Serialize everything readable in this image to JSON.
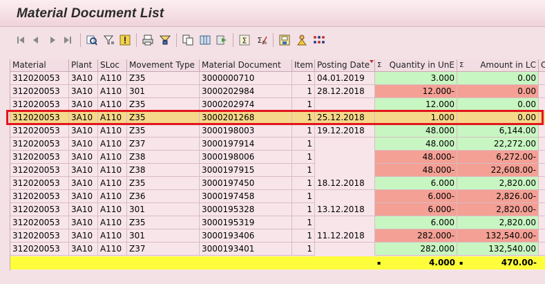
{
  "window": {
    "title": "Material Document List"
  },
  "toolbar": {
    "icons": [
      "first-page-icon",
      "previous-page-icon",
      "next-page-icon",
      "last-page-icon",
      "details-icon",
      "filter-icon",
      "exception-icon",
      "print-icon",
      "sum-up-icon",
      "export-icon",
      "layout-icon",
      "transfer-icon",
      "sum-icon",
      "subtotal-icon",
      "save-layout-icon",
      "user-icon",
      "legend-icon"
    ]
  },
  "columns": [
    "Material",
    "Plant",
    "SLoc",
    "Movement Type",
    "Material Document",
    "Item",
    "Posting Date",
    "Quantity in UnE",
    "Amount in LC"
  ],
  "sum_symbol": "Σ",
  "rows": [
    {
      "material": "312020053",
      "plant": "3A10",
      "sloc": "A110",
      "mvt": "Z35",
      "doc": "3000000710",
      "item": "1",
      "date": "04.01.2019",
      "qty": "3.000",
      "qty_color": "green",
      "amt": "0.00",
      "amt_color": "green"
    },
    {
      "material": "312020053",
      "plant": "3A10",
      "sloc": "A110",
      "mvt": "301",
      "doc": "3000202984",
      "item": "1",
      "date": "28.12.2018",
      "qty": "12.000-",
      "qty_color": "red",
      "amt": "0.00",
      "amt_color": "red"
    },
    {
      "material": "312020053",
      "plant": "3A10",
      "sloc": "A110",
      "mvt": "Z35",
      "doc": "3000202974",
      "item": "1",
      "date": "",
      "qty": "12.000",
      "qty_color": "green",
      "amt": "0.00",
      "amt_color": "green"
    },
    {
      "material": "312020053",
      "plant": "3A10",
      "sloc": "A110",
      "mvt": "Z35",
      "doc": "3000201268",
      "item": "1",
      "date": "25.12.2018",
      "qty": "1.000",
      "qty_color": "selected",
      "amt": "0.00",
      "amt_color": "selected",
      "selected": true
    },
    {
      "material": "312020053",
      "plant": "3A10",
      "sloc": "A110",
      "mvt": "Z35",
      "doc": "3000198003",
      "item": "1",
      "date": "19.12.2018",
      "qty": "48.000",
      "qty_color": "green",
      "amt": "6,144.00",
      "amt_color": "green"
    },
    {
      "material": "312020053",
      "plant": "3A10",
      "sloc": "A110",
      "mvt": "Z37",
      "doc": "3000197914",
      "item": "1",
      "date": "",
      "qty": "48.000",
      "qty_color": "green",
      "amt": "22,272.00",
      "amt_color": "green"
    },
    {
      "material": "312020053",
      "plant": "3A10",
      "sloc": "A110",
      "mvt": "Z38",
      "doc": "3000198006",
      "item": "1",
      "date": "",
      "qty": "48.000-",
      "qty_color": "red",
      "amt": "6,272.00-",
      "amt_color": "red"
    },
    {
      "material": "312020053",
      "plant": "3A10",
      "sloc": "A110",
      "mvt": "Z38",
      "doc": "3000197915",
      "item": "1",
      "date": "",
      "qty": "48.000-",
      "qty_color": "red",
      "amt": "22,608.00-",
      "amt_color": "red"
    },
    {
      "material": "312020053",
      "plant": "3A10",
      "sloc": "A110",
      "mvt": "Z35",
      "doc": "3000197450",
      "item": "1",
      "date": "18.12.2018",
      "qty": "6.000",
      "qty_color": "green",
      "amt": "2,820.00",
      "amt_color": "green"
    },
    {
      "material": "312020053",
      "plant": "3A10",
      "sloc": "A110",
      "mvt": "Z36",
      "doc": "3000197458",
      "item": "1",
      "date": "",
      "qty": "6.000-",
      "qty_color": "red",
      "amt": "2,826.00-",
      "amt_color": "red"
    },
    {
      "material": "312020053",
      "plant": "3A10",
      "sloc": "A110",
      "mvt": "301",
      "doc": "3000195328",
      "item": "1",
      "date": "13.12.2018",
      "qty": "6.000-",
      "qty_color": "red",
      "amt": "2,820.00-",
      "amt_color": "red"
    },
    {
      "material": "312020053",
      "plant": "3A10",
      "sloc": "A110",
      "mvt": "Z35",
      "doc": "3000195319",
      "item": "1",
      "date": "",
      "qty": "6.000",
      "qty_color": "green",
      "amt": "2,820.00",
      "amt_color": "green"
    },
    {
      "material": "312020053",
      "plant": "3A10",
      "sloc": "A110",
      "mvt": "301",
      "doc": "3000193406",
      "item": "1",
      "date": "11.12.2018",
      "qty": "282.000-",
      "qty_color": "red",
      "amt": "132,540.00-",
      "amt_color": "red"
    },
    {
      "material": "312020053",
      "plant": "3A10",
      "sloc": "A110",
      "mvt": "Z37",
      "doc": "3000193401",
      "item": "1",
      "date": "",
      "qty": "282.000",
      "qty_color": "green",
      "amt": "132,540.00",
      "amt_color": "green"
    }
  ],
  "totals": {
    "qty": "4.000",
    "amt": "470.00-",
    "marker": "▪"
  },
  "colors": {
    "green": "#c8f6c2",
    "red": "#f4a095",
    "selected": "#f6d88a",
    "total": "#fdfd3b",
    "highlight_border": "#e2151b"
  }
}
